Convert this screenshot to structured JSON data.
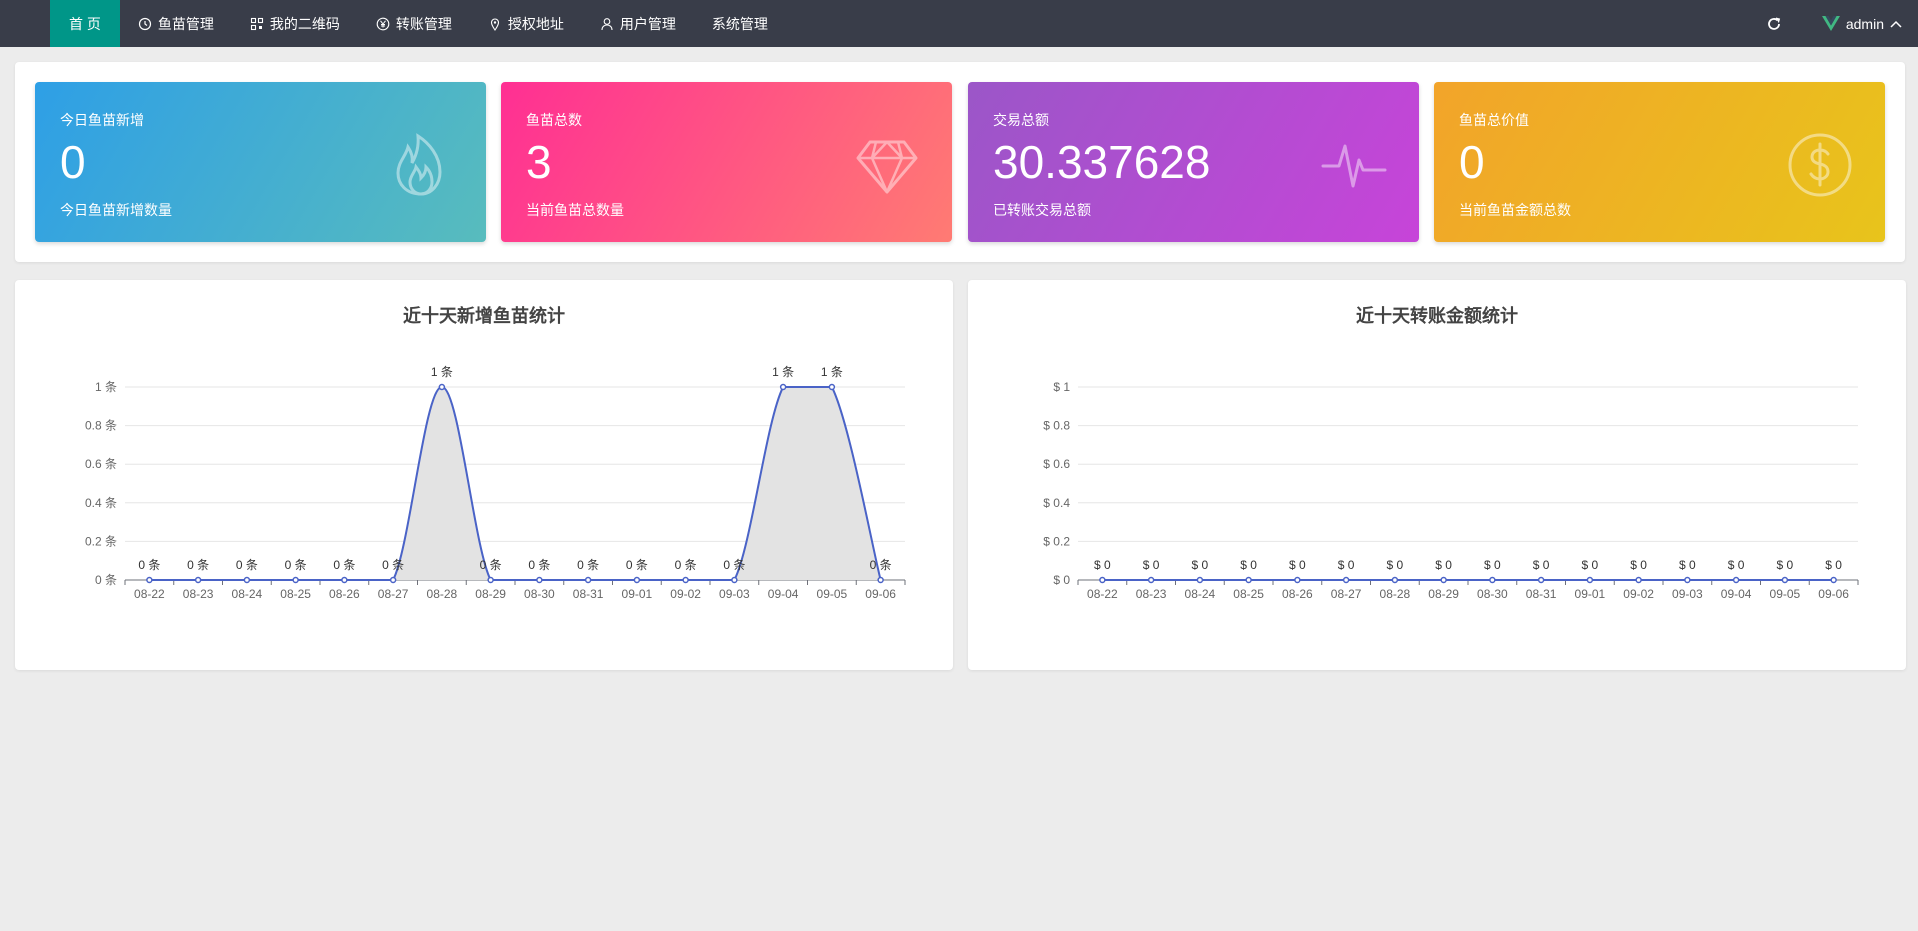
{
  "nav": {
    "items": [
      {
        "label": "首 页",
        "icon": "",
        "active": true
      },
      {
        "label": "鱼苗管理",
        "icon": "timer-icon"
      },
      {
        "label": "我的二维码",
        "icon": "qrcode-icon"
      },
      {
        "label": "转账管理",
        "icon": "yen-icon"
      },
      {
        "label": "授权地址",
        "icon": "location-icon"
      },
      {
        "label": "用户管理",
        "icon": "user-icon"
      },
      {
        "label": "系统管理",
        "icon": ""
      }
    ],
    "user": "admin"
  },
  "cards": [
    {
      "title": "今日鱼苗新增",
      "value": "0",
      "subtitle": "今日鱼苗新增数量",
      "icon": "fire-icon"
    },
    {
      "title": "鱼苗总数",
      "value": "3",
      "subtitle": "当前鱼苗总数量",
      "icon": "diamond-icon"
    },
    {
      "title": "交易总额",
      "value": "30.337628",
      "subtitle": "已转账交易总额",
      "icon": "pulse-icon"
    },
    {
      "title": "鱼苗总价值",
      "value": "0",
      "subtitle": "当前鱼苗金额总数",
      "icon": "dollar-icon"
    }
  ],
  "colors": {
    "topbar": "#393d49",
    "nav_active": "#009688",
    "line": "#4a63c7",
    "area": "#e3e3e3"
  },
  "chart_data": [
    {
      "type": "area",
      "title": "近十天新增鱼苗统计",
      "x": [
        "08-22",
        "08-23",
        "08-24",
        "08-25",
        "08-26",
        "08-27",
        "08-28",
        "08-29",
        "08-30",
        "08-31",
        "09-01",
        "09-02",
        "09-03",
        "09-04",
        "09-05",
        "09-06"
      ],
      "values": [
        0,
        0,
        0,
        0,
        0,
        0,
        1,
        0,
        0,
        0,
        0,
        0,
        0,
        1,
        1,
        0
      ],
      "value_labels": [
        "0 条",
        "0 条",
        "0 条",
        "0 条",
        "0 条",
        "0 条",
        "1 条",
        "0 条",
        "0 条",
        "0 条",
        "0 条",
        "0 条",
        "0 条",
        "1 条",
        "1 条",
        "0 条"
      ],
      "y_ticks": [
        "0 条",
        "0.2 条",
        "0.4 条",
        "0.6 条",
        "0.8 条",
        "1 条"
      ],
      "ylim": [
        0,
        1
      ],
      "grid": true
    },
    {
      "type": "line",
      "title": "近十天转账金额统计",
      "x": [
        "08-22",
        "08-23",
        "08-24",
        "08-25",
        "08-26",
        "08-27",
        "08-28",
        "08-29",
        "08-30",
        "08-31",
        "09-01",
        "09-02",
        "09-03",
        "09-04",
        "09-05",
        "09-06"
      ],
      "values": [
        0,
        0,
        0,
        0,
        0,
        0,
        0,
        0,
        0,
        0,
        0,
        0,
        0,
        0,
        0,
        0
      ],
      "value_labels": [
        "$ 0",
        "$ 0",
        "$ 0",
        "$ 0",
        "$ 0",
        "$ 0",
        "$ 0",
        "$ 0",
        "$ 0",
        "$ 0",
        "$ 0",
        "$ 0",
        "$ 0",
        "$ 0",
        "$ 0",
        "$ 0"
      ],
      "y_ticks": [
        "$ 0",
        "$ 0.2",
        "$ 0.4",
        "$ 0.6",
        "$ 0.8",
        "$ 1"
      ],
      "ylim": [
        0,
        1
      ],
      "grid": true
    }
  ]
}
